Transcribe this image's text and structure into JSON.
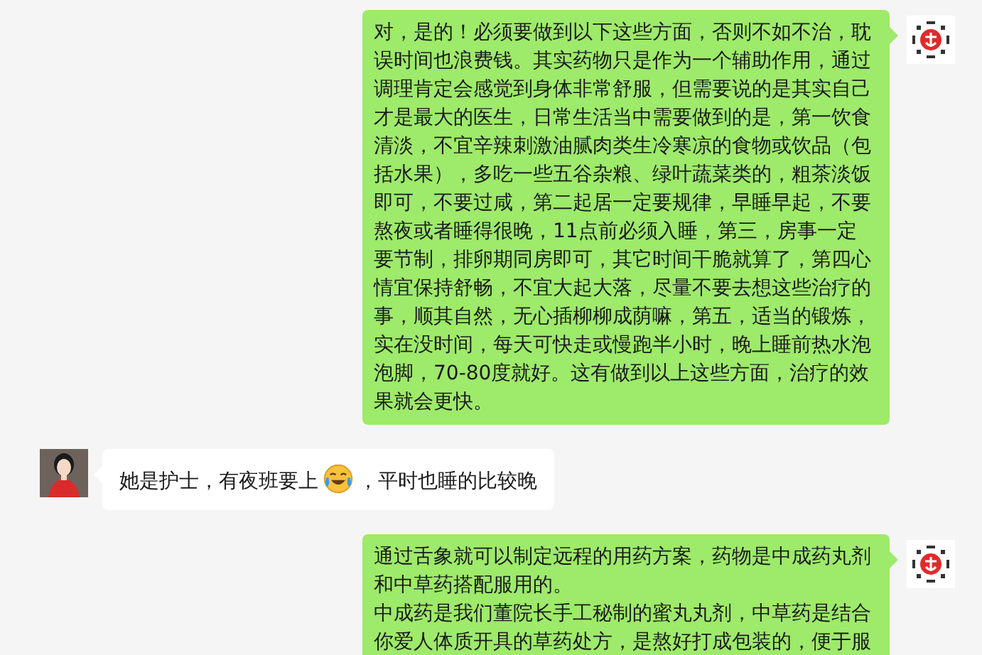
{
  "messages": [
    {
      "from_me": true,
      "lines": [
        "对，是的！必须要做到以下这些方面，否则不如不治，耽",
        "误时间也浪费钱。其实药物只是作为一个辅助作用，通过",
        "调理肯定会感觉到身体非常舒服，但需要说的是其实自己",
        "才是最大的医生，日常生活当中需要做到的是，第一饮食",
        "清淡，不宜辛辣刺激油腻肉类生冷寒凉的食物或饮品（包",
        "括水果），多吃一些五谷杂粮、绿叶蔬菜类的，粗茶淡饭",
        "即可，不要过咸，第二起居一定要规律，早睡早起，不要",
        "熬夜或者睡得很晚，11点前必须入睡，第三，房事一定",
        "要节制，排卵期同房即可，其它时间干脆就算了，第四心",
        "情宜保持舒畅，不宜大起大落，尽量不要去想这些治疗的",
        "事，顺其自然，无心插柳柳成荫嘛，第五，适当的锻炼，",
        "实在没时间，每天可快走或慢跑半小时，晚上睡前热水泡",
        "泡脚，70-80度就好。这有做到以上这些方面，治疗的效",
        "果就会更快。"
      ]
    },
    {
      "from_me": false,
      "parts": [
        {
          "kind": "text",
          "text": "她是护士，有夜班要上"
        },
        {
          "kind": "emoji"
        },
        {
          "kind": "text",
          "text": "，平时也睡的比较晚"
        }
      ]
    },
    {
      "from_me": true,
      "lines": [
        "通过舌象就可以制定远程的用药方案，药物是中成药丸剂",
        "和中草药搭配服用的。",
        "中成药是我们董院长手工秘制的蜜丸丸剂，中草药是结合",
        "你爱人体质开具的草药处方，是熬好打成包装的，便于服"
      ]
    }
  ]
}
